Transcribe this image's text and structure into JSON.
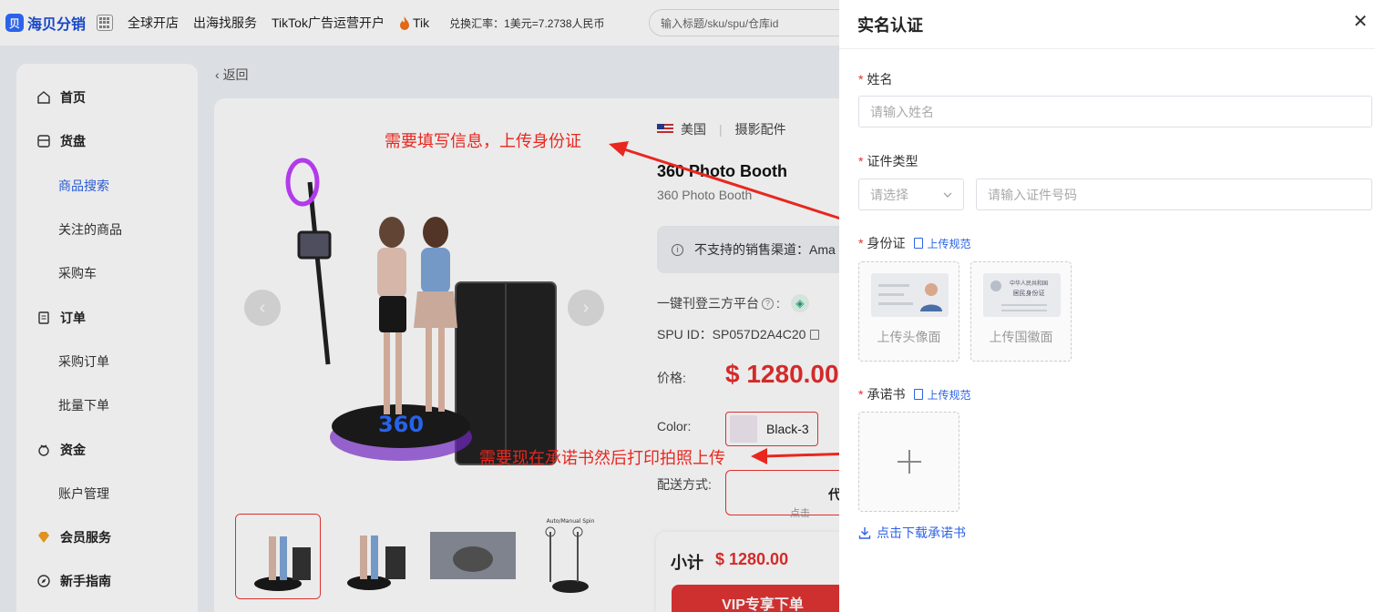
{
  "header": {
    "logo_mark": "贝",
    "logo_text": "海贝分销",
    "nav": [
      "全球开店",
      "出海找服务",
      "TikTok广告运营开户",
      "Tik"
    ],
    "rate": "兑换汇率：1美元=7.2738人民币",
    "search_placeholder": "输入标题/sku/spu/仓库id"
  },
  "sidebar": {
    "items": [
      {
        "label": "首页",
        "icon": "home-icon"
      },
      {
        "label": "货盘",
        "icon": "shelf-icon"
      },
      {
        "label": "商品搜索",
        "sub": true,
        "active": true
      },
      {
        "label": "关注的商品",
        "sub": true
      },
      {
        "label": "采购车",
        "sub": true
      },
      {
        "label": "订单",
        "icon": "order-icon"
      },
      {
        "label": "采购订单",
        "sub": true
      },
      {
        "label": "批量下单",
        "sub": true
      },
      {
        "label": "资金",
        "icon": "wallet-icon"
      },
      {
        "label": "账户管理",
        "sub": true
      },
      {
        "label": "会员服务",
        "icon": "diamond-icon"
      },
      {
        "label": "新手指南",
        "icon": "compass-icon"
      }
    ]
  },
  "product": {
    "back": "返回",
    "country": "美国",
    "category": "摄影配件",
    "title": "360 Photo Booth",
    "subtitle": "360 Photo Booth",
    "unsupported": "不支持的销售渠道：Ama",
    "publish": "一键刊登三方平台",
    "spu": "SPU ID：SP057D2A4C20",
    "price_label": "价格:",
    "price": "$ 1280.00",
    "color_label": "Color:",
    "color_value": "Black-3",
    "ship_label": "配送方式:",
    "ship_value": "代",
    "ship_sub": "点击",
    "subtotal_label": "小计",
    "subtotal_value": "$ 1280.00",
    "buy_button": "VIP专享下单",
    "thumb_caption": "Auto/Manual Spin"
  },
  "annotations": {
    "note1": "需要填写信息，上传身份证",
    "note2": "需要现在承诺书然后打印拍照上传"
  },
  "drawer": {
    "title": "实名认证",
    "name_label": "姓名",
    "name_placeholder": "请输入姓名",
    "id_type_label": "证件类型",
    "id_type_placeholder": "请选择",
    "id_no_placeholder": "请输入证件号码",
    "idcard_label": "身份证",
    "upload_guide": "上传规范",
    "front_caption": "上传头像面",
    "back_caption": "上传国徽面",
    "id_back_title1": "中华人民共和国",
    "id_back_title2": "居民身份证",
    "pledge_label": "承诺书",
    "download": "点击下载承诺书",
    "required_mark": "*"
  },
  "colors": {
    "accent": "#2d63e6",
    "danger": "#e5322d",
    "price": "#e52e2e"
  }
}
